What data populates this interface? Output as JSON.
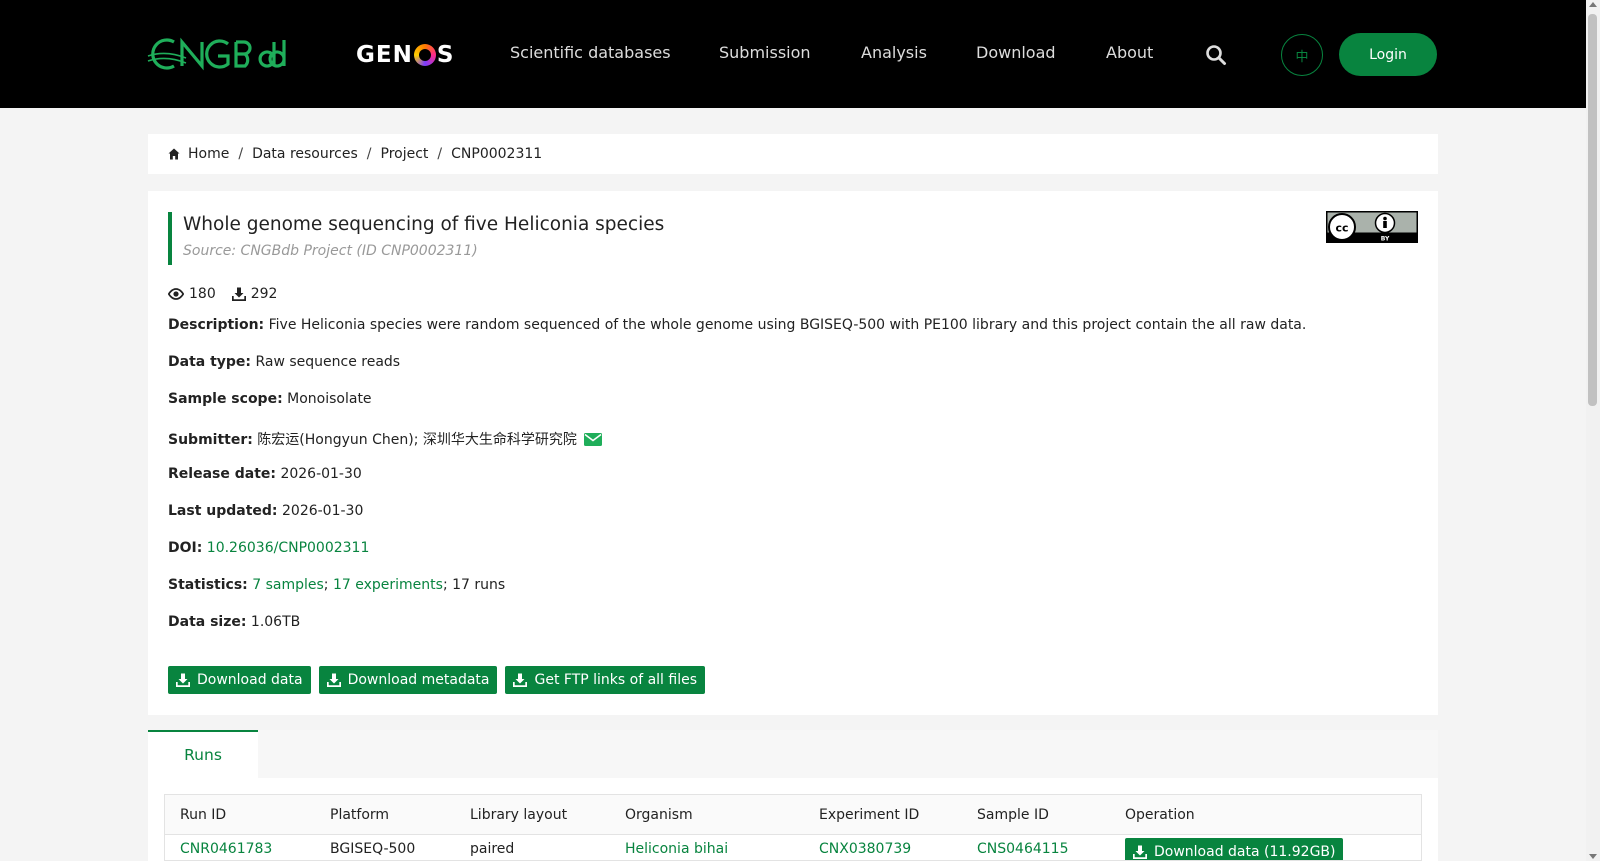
{
  "header": {
    "brand_cngb": "CNGBdb",
    "brand_genos": "GENOS",
    "nav": [
      "Scientific databases",
      "Submission",
      "Analysis",
      "Download",
      "About"
    ],
    "lang_label": "中",
    "login_label": "Login"
  },
  "breadcrumb": [
    "Home",
    "Data resources",
    "Project",
    "CNP0002311"
  ],
  "project": {
    "title": "Whole genome sequencing of five Heliconia species",
    "source": "Source: CNGBdb Project (ID CNP0002311)",
    "views": "180",
    "downloads": "292",
    "fields": {
      "description_label": "Description:",
      "description": "Five Heliconia species were random sequenced of the whole genome using BGISEQ-500 with PE100 library and this project contain the all raw data.",
      "data_type_label": "Data type:",
      "data_type": "Raw sequence reads",
      "sample_scope_label": "Sample scope:",
      "sample_scope": "Monoisolate",
      "submitter_label": "Submitter:",
      "submitter": "陈宏运(Hongyun Chen); 深圳华大生命科学研究院",
      "release_label": "Release date:",
      "release_date": "2026-01-30",
      "updated_label": "Last updated:",
      "last_updated": "2026-01-30",
      "doi_label": "DOI:",
      "doi": "10.26036/CNP0002311",
      "statistics_label": "Statistics:",
      "stat_samples": "7 samples",
      "stat_sep1": ";",
      "stat_experiments": "17 experiments",
      "stat_runs": "; 17 runs",
      "size_label": "Data size:",
      "data_size": "1.06TB"
    },
    "buttons": {
      "download_data": "Download data",
      "download_metadata": "Download metadata",
      "ftp_links": "Get FTP links of all files"
    }
  },
  "runs": {
    "tab_label": "Runs",
    "columns": [
      "Run ID",
      "Platform",
      "Library layout",
      "Organism",
      "Experiment ID",
      "Sample ID",
      "Operation"
    ],
    "rows": [
      {
        "run_id": "CNR0461783",
        "platform": "BGISEQ-500",
        "layout": "paired",
        "organism": "Heliconia bihai",
        "experiment_id": "CNX0380739",
        "sample_id": "CNS0464115",
        "operation": "Download data (11.92GB)"
      }
    ]
  },
  "colors": {
    "brand_green": "#08843f",
    "header_bg": "#000000",
    "page_bg": "#f4f4f4"
  },
  "icons": [
    "home-icon",
    "eye-icon",
    "download-icon",
    "mail-icon",
    "search-icon",
    "cc-by-license-icon"
  ]
}
